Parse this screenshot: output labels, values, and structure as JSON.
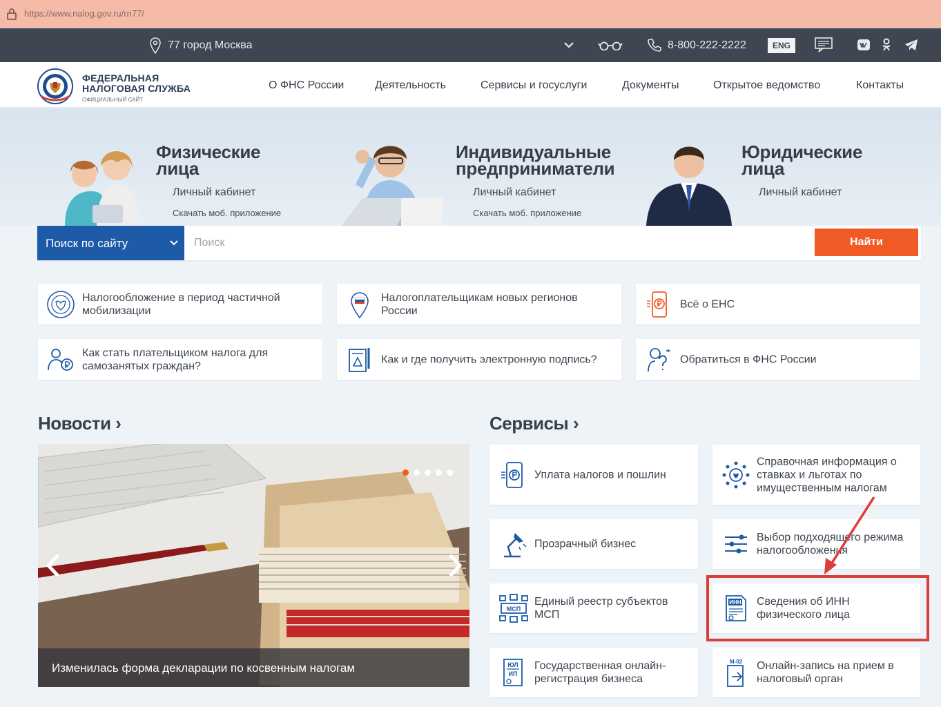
{
  "browser": {
    "url": "https://www.nalog.gov.ru/rn77/"
  },
  "topbar": {
    "region": "77 город Москва",
    "phone": "8-800-222-2222",
    "lang": "ENG"
  },
  "header": {
    "logo_line1": "ФЕДЕРАЛЬНАЯ",
    "logo_line2": "НАЛОГОВАЯ СЛУЖБА",
    "logo_sub": "ОФИЦИАЛЬНЫЙ САЙТ",
    "nav": [
      "О ФНС России",
      "Деятельность",
      "Сервисы и госуслуги",
      "Документы",
      "Открытое ведомство",
      "Контакты"
    ]
  },
  "segments": [
    {
      "title1": "Физические",
      "title2": "лица",
      "link": "Личный кабинет",
      "app": "Скачать моб. приложение"
    },
    {
      "title1": "Индивидуальные",
      "title2": "предприниматели",
      "link": "Личный кабинет",
      "app": "Скачать моб. приложение"
    },
    {
      "title1": "Юридические",
      "title2": "лица",
      "link": "Личный кабинет"
    }
  ],
  "search": {
    "scope": "Поиск по сайту",
    "placeholder": "Поиск",
    "button": "Найти"
  },
  "quick_links": [
    "Налогообложение в период частичной мобилизации",
    "Налогоплательщикам новых регионов России",
    "Всё о ЕНС",
    "Как стать плательщиком налога для самозанятых граждан?",
    "Как и где получить электронную подпись?",
    "Обратиться в ФНС России"
  ],
  "news": {
    "title": "Новости",
    "caption": "Изменилась форма декларации по косвенным налогам"
  },
  "services": {
    "title": "Сервисы",
    "items": [
      "Уплата налогов и пошлин",
      "Справочная информация о ставках и льготах по имущественным налогам",
      "Прозрачный бизнес",
      "Выбор подходящего режима налогообложения",
      "Единый реестр субъектов МСП",
      "Сведения об ИНН физического лица",
      "Государственная онлайн-регистрация бизнеса",
      "Онлайн-запись на прием в налоговый орган"
    ],
    "icon_labels": {
      "inn": "ИНН",
      "msp": "МСП",
      "ul": "ЮЛ",
      "ip": "ИП",
      "m02": "М-02"
    }
  },
  "colors": {
    "accent": "#f05a24",
    "primary": "#1d5aa8",
    "highlight": "#d9403b",
    "topbar": "#3f4551"
  }
}
